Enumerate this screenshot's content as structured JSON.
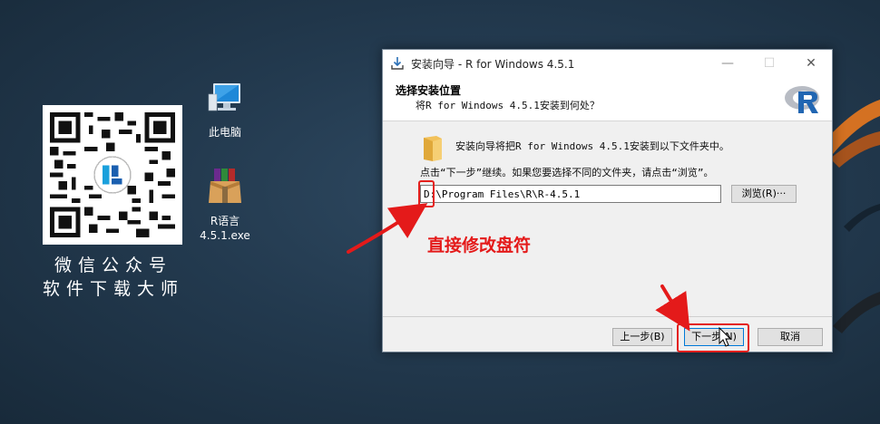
{
  "qr_caption": {
    "line1": "微信公众号",
    "line2": "软件下载大师"
  },
  "desktop": {
    "icons": [
      {
        "label": "此电脑",
        "icon": "computer-icon"
      },
      {
        "label_line1": "R语言",
        "label_line2": "4.5.1.exe",
        "icon": "winrar-archive-icon"
      }
    ]
  },
  "window": {
    "title": "安装向导 - R for Windows 4.5.1",
    "header_title": "选择安装位置",
    "header_subtitle": "将R for Windows 4.5.1安装到何处？",
    "description": "安装向导将把R for Windows 4.5.1安装到以下文件夹中。",
    "hint": "点击“下一步”继续。如果您要选择不同的文件夹，请点击“浏览”。",
    "path_value": "D:\\Program Files\\R\\R-4.5.1",
    "browse_label": "浏览(R)···",
    "back_label": "上一步(B)",
    "next_label": "下一步(N)",
    "cancel_label": "取消",
    "controls": {
      "minimize": "—",
      "maximize": "☐",
      "close": "✕"
    }
  },
  "annotation": {
    "text": "直接修改盘符",
    "color": "#e41a1a"
  },
  "colors": {
    "desktop_bg": "#233a4f",
    "ribbon": "#e8781e",
    "annotation_red": "#e41a1a"
  }
}
